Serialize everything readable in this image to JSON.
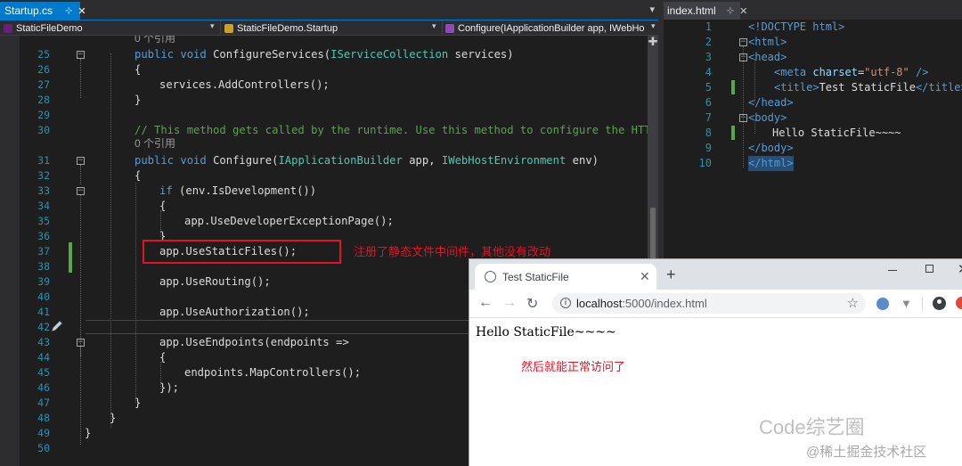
{
  "left_editor": {
    "tab_title": "Startup.cs",
    "nav": {
      "project": "StaticFileDemo",
      "class": "StaticFileDemo.Startup",
      "member": "Configure(IApplicationBuilder app, IWebHo"
    },
    "line_numbers": [
      "25",
      "26",
      "27",
      "28",
      "29",
      "30",
      "31",
      "32",
      "33",
      "34",
      "35",
      "36",
      "37",
      "38",
      "39",
      "40",
      "41",
      "42",
      "43",
      "44",
      "45",
      "46",
      "47",
      "48",
      "49",
      "50"
    ],
    "references_label": "0 个引用",
    "code": {
      "l25_a": "public void ",
      "l25_b": "ConfigureServices(",
      "l25_c": "IServiceCollection",
      "l25_d": " services)",
      "l26": "{",
      "l27": "services.AddControllers();",
      "l28": "}",
      "l30": "// This method gets called by the runtime. Use this method to configure the HTTP r",
      "l31_a": "public void ",
      "l31_b": "Configure(",
      "l31_c": "IApplicationBuilder",
      "l31_d": " app, ",
      "l31_e": "IWebHostEnvironment",
      "l31_f": " env)",
      "l32": "{",
      "l33_a": "if",
      "l33_b": " (env.IsDevelopment())",
      "l34": "{",
      "l35": "app.UseDeveloperExceptionPage();",
      "l36": "}",
      "l37": "app.UseStaticFiles();",
      "l39": "app.UseRouting();",
      "l41": "app.UseAuthorization();",
      "l43": "app.UseEndpoints(endpoints =>",
      "l44": "{",
      "l45": "endpoints.MapControllers();",
      "l46": "});",
      "l47": "}",
      "l48": "}",
      "l49": "}"
    },
    "annotation": "注册了静态文件中间件，其他没有改动"
  },
  "right_editor": {
    "tab_title": "index.html",
    "line_numbers": [
      "1",
      "2",
      "3",
      "4",
      "5",
      "6",
      "7",
      "8",
      "9",
      "10"
    ],
    "code": {
      "l1": "<!DOCTYPE html>",
      "l2": "<html>",
      "l3": "<head>",
      "l4_tag": "<meta ",
      "l4_attr": "charset",
      "l4_eq": "=",
      "l4_val": "\"utf-8\"",
      "l4_end": " />",
      "l5_open": "<title>",
      "l5_text": "Test StaticFile",
      "l5_close": "</title>",
      "l6": "</head>",
      "l7": "<body>",
      "l8": "Hello StaticFile~~~~",
      "l9": "</body>",
      "l10": "</html>"
    }
  },
  "browser": {
    "tab_title": "Test StaticFile",
    "url_host": "localhost",
    "url_path": ":5000/index.html",
    "page_text": "Hello StaticFile~~~~",
    "annotation": "然后就能正常访问了"
  },
  "watermark": {
    "line1": "Code综艺圈",
    "line2": "@稀土掘金技术社区"
  },
  "colors": {
    "editor_bg": "#1e1e1e",
    "accent": "#007acc",
    "annotation_red": "#e81123",
    "keyword": "#569cd6",
    "type": "#4ec9b0",
    "comment": "#57a64a"
  }
}
